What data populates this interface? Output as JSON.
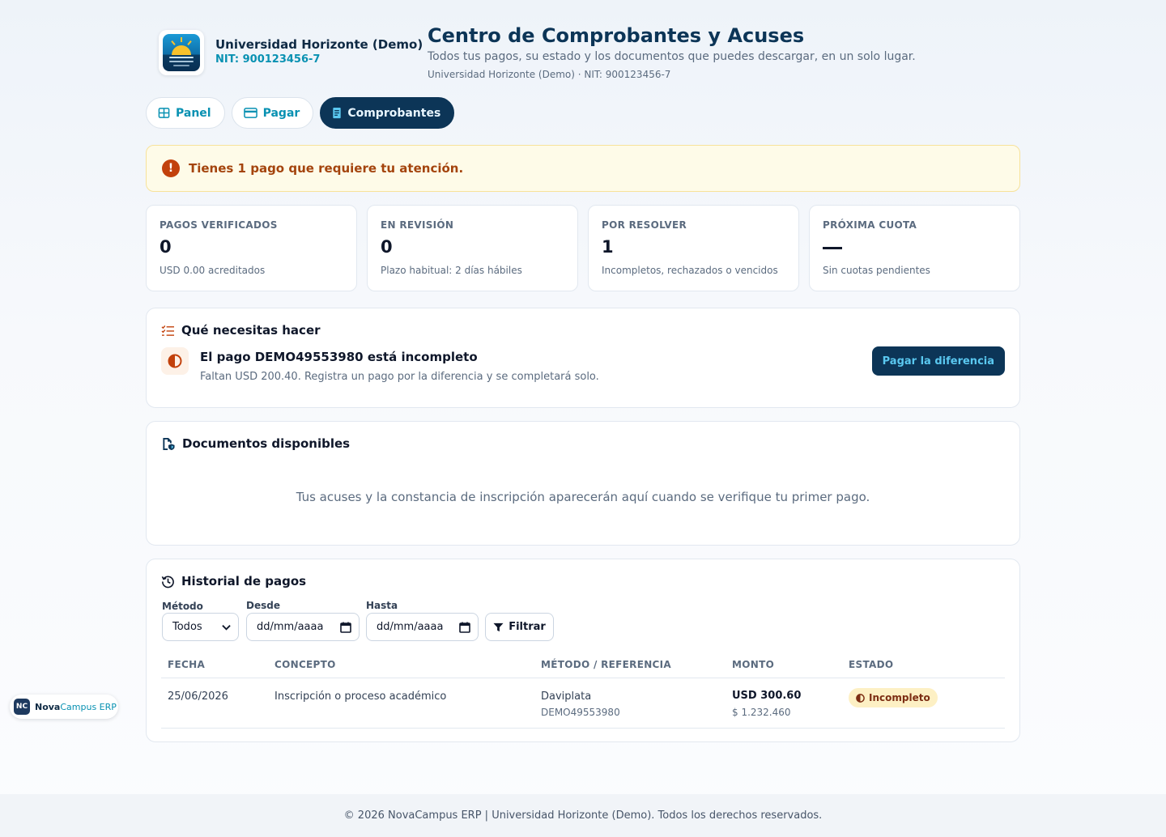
{
  "org": {
    "name": "Universidad Horizonte (Demo)",
    "nit": "NIT: 900123456-7"
  },
  "page": {
    "title": "Centro de Comprobantes y Acuses",
    "subtitle": "Todos tus pagos, su estado y los documentos que puedes descargar, en un solo lugar.",
    "meta": "Universidad Horizonte (Demo) · NIT: 900123456-7"
  },
  "nav": [
    {
      "label": "Panel",
      "icon": "grid-icon",
      "active": false
    },
    {
      "label": "Pagar",
      "icon": "credit-card-icon",
      "active": false
    },
    {
      "label": "Comprobantes",
      "icon": "receipt-icon",
      "active": true
    }
  ],
  "alert": {
    "text": "Tienes 1 pago que requiere tu atención.",
    "icon": "exclamation-icon"
  },
  "stats": [
    {
      "label": "PAGOS VERIFICADOS",
      "value": "0",
      "note": "USD 0.00 acreditados"
    },
    {
      "label": "EN REVISIÓN",
      "value": "0",
      "note": "Plazo habitual: 2 días hábiles"
    },
    {
      "label": "POR RESOLVER",
      "value": "1",
      "note": "Incompletos, rechazados o vencidos"
    },
    {
      "label": "PRÓXIMA CUOTA",
      "value": "",
      "note": "Sin cuotas pendientes"
    }
  ],
  "todo": {
    "title": "Qué necesitas hacer",
    "item_title": "El pago DEMO49553980 está incompleto",
    "item_desc": "Faltan USD 200.40. Registra un pago por la diferencia y se completará solo.",
    "button": "Pagar la diferencia"
  },
  "docs": {
    "title": "Documentos disponibles",
    "empty": "Tus acuses y la constancia de inscripción aparecerán aquí cuando se verifique tu primer pago."
  },
  "history": {
    "title": "Historial de pagos",
    "filters": {
      "method_label": "Método",
      "method_value": "Todos",
      "from_label": "Desde",
      "from_placeholder": "dd/mm/aaaa",
      "to_label": "Hasta",
      "to_placeholder": "dd/mm/aaaa",
      "filter_button": "Filtrar"
    },
    "columns": [
      "FECHA",
      "CONCEPTO",
      "MÉTODO / REFERENCIA",
      "MONTO",
      "ESTADO"
    ],
    "rows": [
      {
        "date": "25/06/2026",
        "concept": "Inscripción o proceso académico",
        "method": "Daviplata",
        "reference": "DEMO49553980",
        "amount": "USD 300.60",
        "amount_local": "$ 1.232.460",
        "status": "Incompleto"
      }
    ]
  },
  "brand": {
    "mark": "NC",
    "name_a": "Nova",
    "name_b": "Campus ERP"
  },
  "footer": "© 2026 NovaCampus ERP | Universidad Horizonte (Demo). Todos los derechos reservados.",
  "colors": {
    "primary": "#0c3557",
    "accent": "#0891b2",
    "warning_bg": "#fefbe8",
    "warning_text": "#a4440d"
  }
}
